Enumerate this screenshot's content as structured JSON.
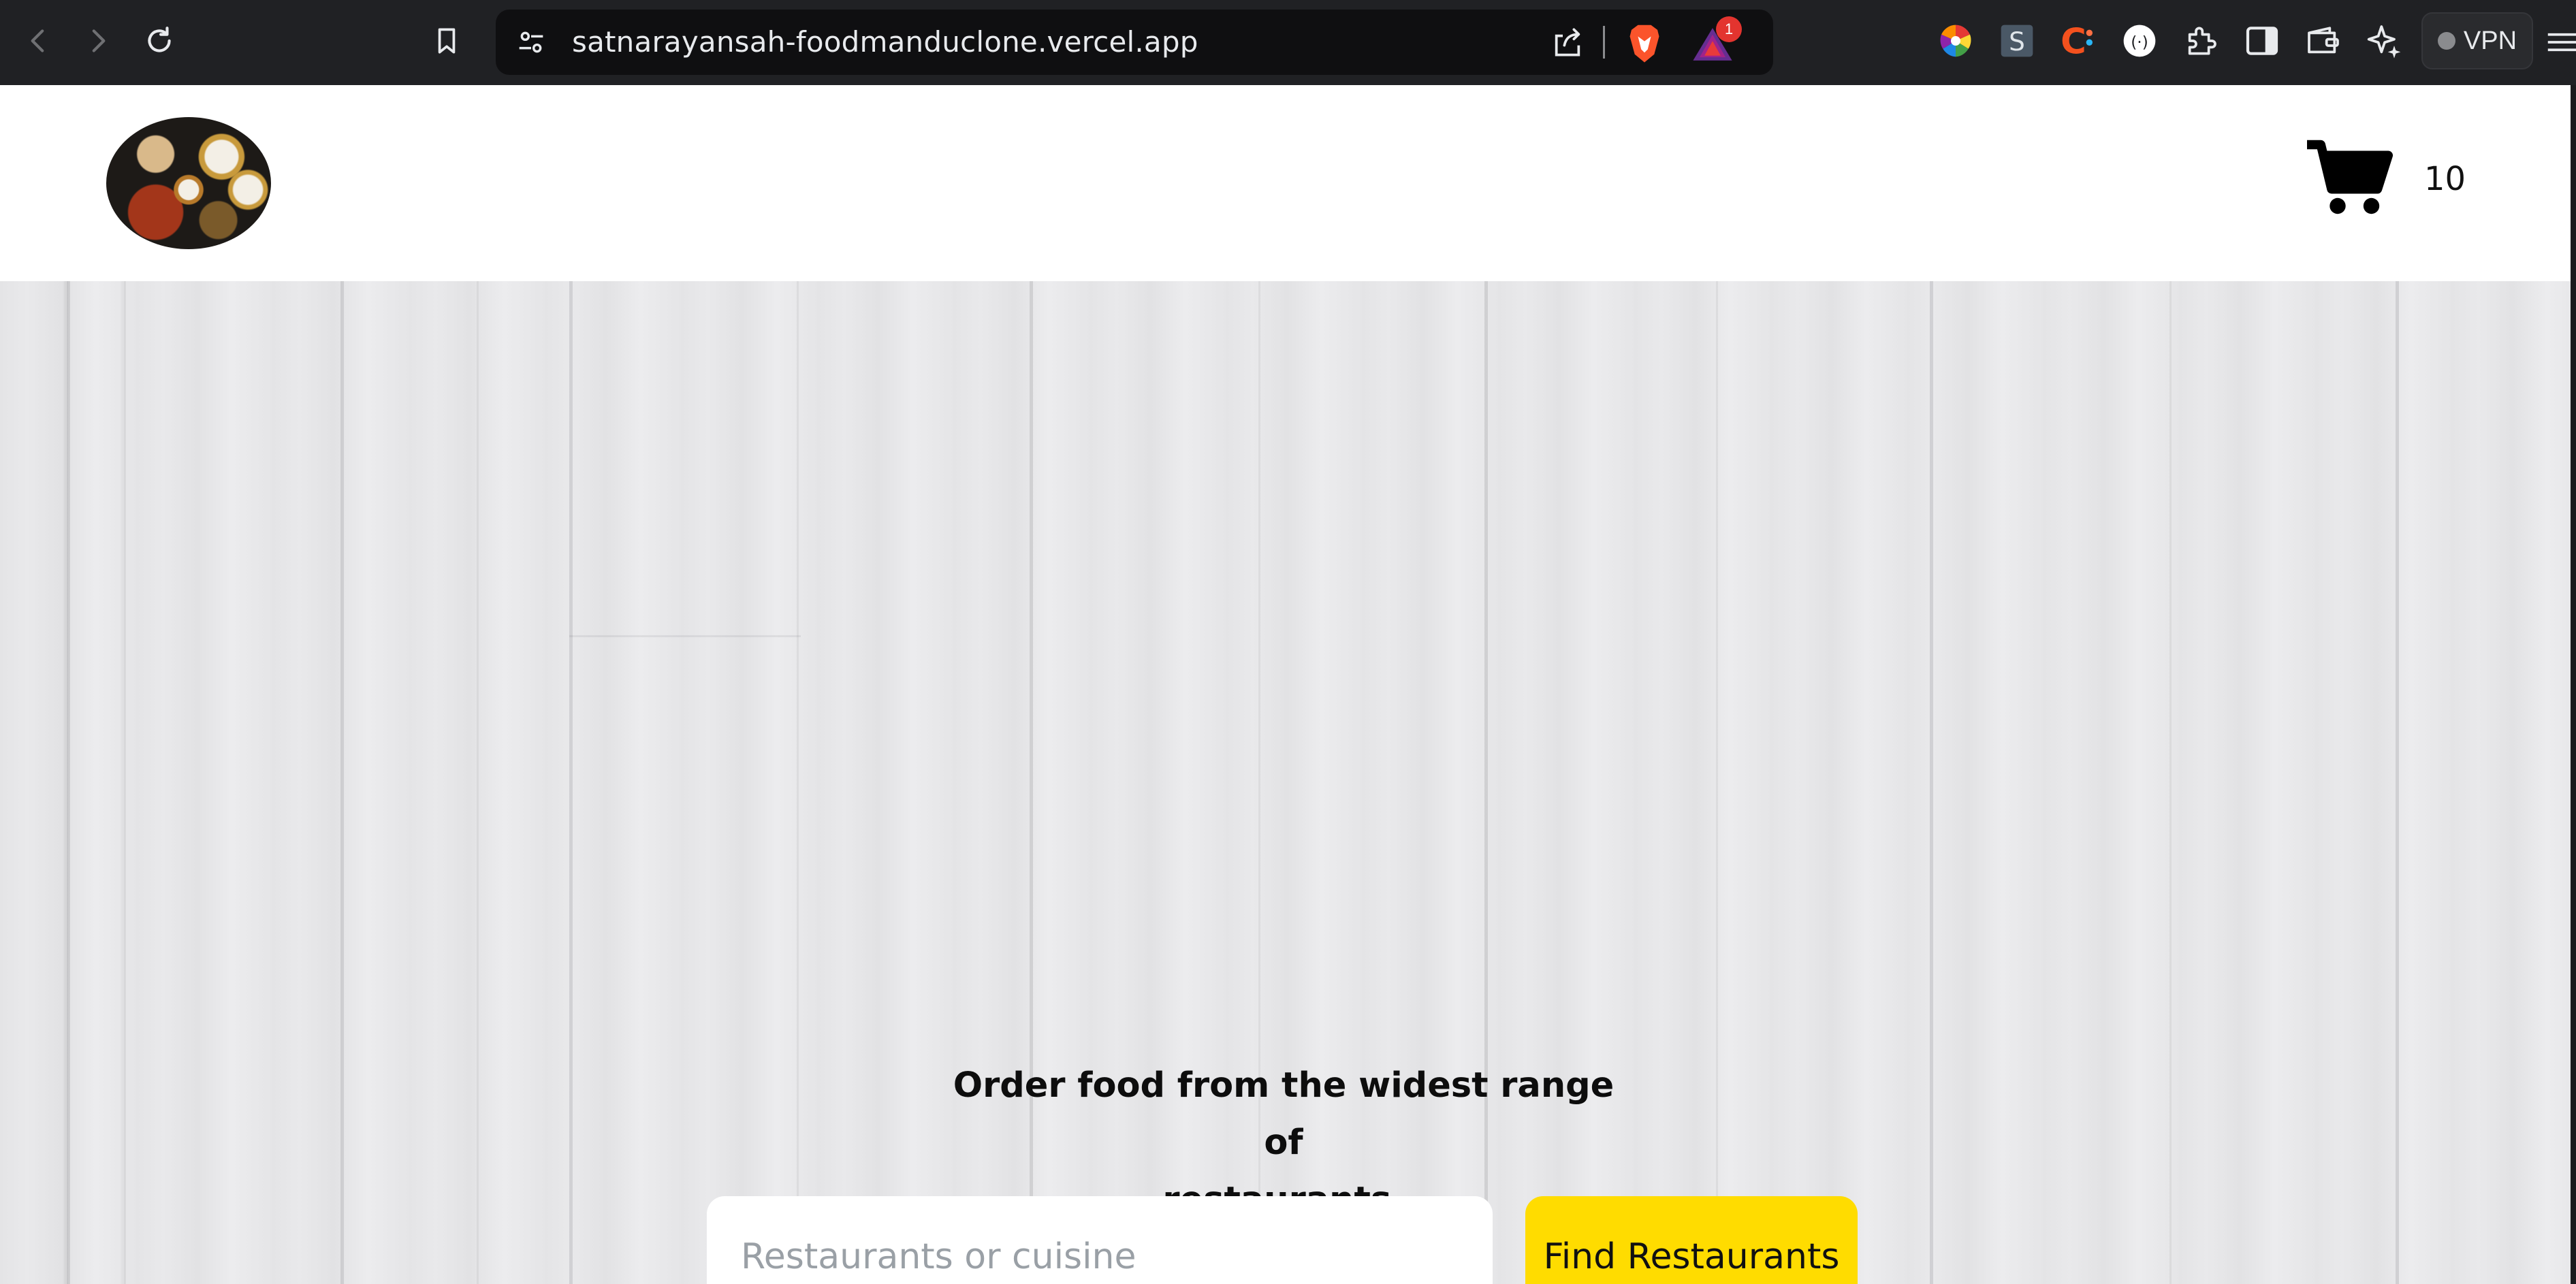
{
  "browser": {
    "url": "satnarayansah-foodmanduclone.vercel.app",
    "rewards_badge_count": "1",
    "vpn_label": "VPN",
    "extensions": [
      "colorpicker-icon",
      "s-extension-icon",
      "c-extension-icon",
      "translate-extension-icon",
      "puzzle-extensions-icon",
      "sidebar-icon",
      "wallet-icon",
      "leo-ai-icon"
    ]
  },
  "header": {
    "cart_count": "10"
  },
  "hero": {
    "tagline_line1": "Order food from the widest range of",
    "tagline_line2": "restaurants.",
    "search_placeholder": "Restaurants or cuisine",
    "search_value": "",
    "find_button_label": "Find Restaurants"
  },
  "colors": {
    "accent": "#ffdc00",
    "chrome_bg": "#202124",
    "hero_bg": "#e7e7e9"
  }
}
